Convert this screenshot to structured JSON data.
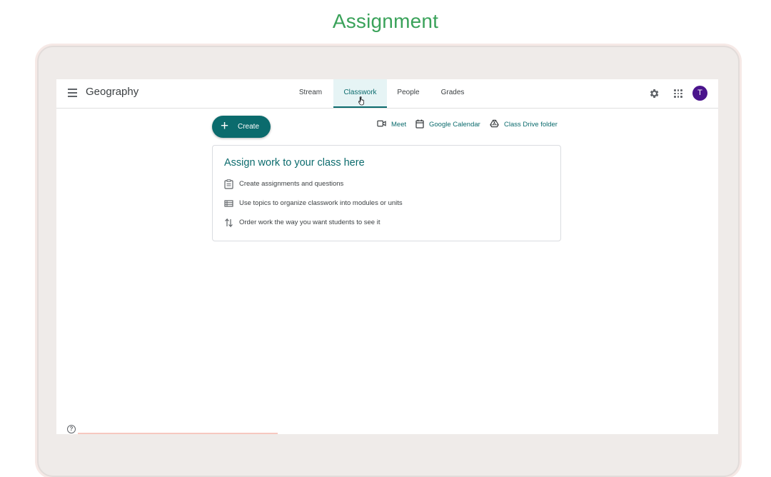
{
  "heading": "Assignment",
  "header": {
    "class_title": "Geography",
    "tabs": [
      {
        "label": "Stream"
      },
      {
        "label": "Classwork"
      },
      {
        "label": "People"
      },
      {
        "label": "Grades"
      }
    ],
    "active_tab": "Classwork",
    "avatar_initial": "T"
  },
  "toolbar": {
    "create_label": "Create",
    "links": [
      {
        "label": "Meet",
        "icon": "video-camera-icon"
      },
      {
        "label": "Google Calendar",
        "icon": "calendar-icon"
      },
      {
        "label": "Class Drive folder",
        "icon": "drive-icon"
      }
    ]
  },
  "card": {
    "title": "Assign work to your class here",
    "items": [
      {
        "text": "Create assignments and questions",
        "icon": "assignment-icon"
      },
      {
        "text": "Use topics to organize classwork into modules or units",
        "icon": "topic-list-icon"
      },
      {
        "text": "Order work the way you want students to see it",
        "icon": "reorder-icon"
      }
    ]
  },
  "colors": {
    "heading": "#3aa25a",
    "accent": "#0b6b6d",
    "avatar": "#4a148c"
  }
}
